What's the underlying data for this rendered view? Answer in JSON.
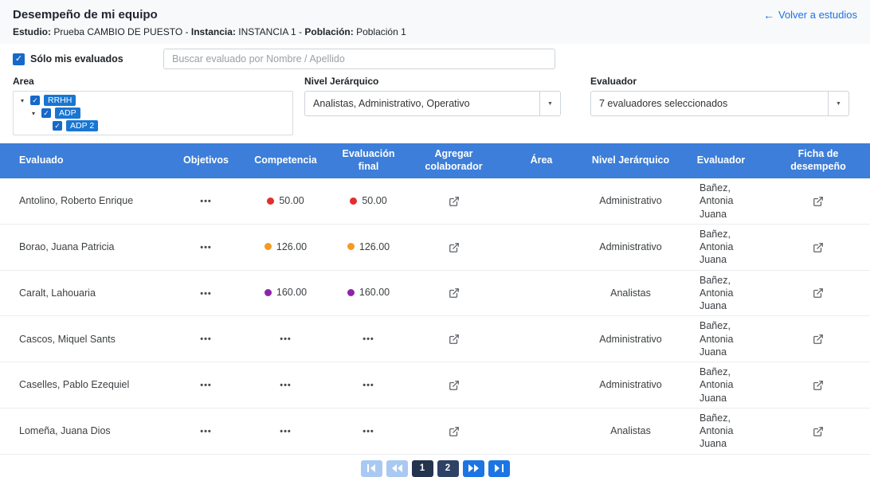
{
  "header": {
    "title": "Desempeño de mi equipo",
    "back_link": "Volver a estudios"
  },
  "study_info": {
    "estudio_label": "Estudio:",
    "estudio_value": "Prueba CAMBIO DE PUESTO",
    "sep1": "-",
    "instancia_label": "Instancia:",
    "instancia_value": "INSTANCIA 1",
    "sep2": "-",
    "poblacion_label": "Población:",
    "poblacion_value": "Población 1"
  },
  "filters": {
    "only_mine_label": "Sólo mis evaluados",
    "only_mine_checked": true,
    "search_placeholder": "Buscar evaluado por Nombre / Apellido",
    "area": {
      "label": "Area",
      "tree": [
        {
          "label": "RRHH",
          "checked": true
        },
        {
          "label": "ADP",
          "checked": true
        },
        {
          "label": "ADP 2",
          "checked": true
        }
      ]
    },
    "nivel": {
      "label": "Nivel Jerárquico",
      "value": "Analistas, Administrativo, Operativo"
    },
    "evaluador": {
      "label": "Evaluador",
      "value": "7 evaluadores seleccionados"
    }
  },
  "table": {
    "columns": [
      "Evaluado",
      "Objetivos",
      "Competencia",
      "Evaluación final",
      "Agregar colaborador",
      "Área",
      "Nivel Jerárquico",
      "Evaluador",
      "Ficha de desempeño"
    ],
    "rows": [
      {
        "evaluado": "Antolino, Roberto Enrique",
        "objetivos": "•••",
        "competencia_dot": "#e02f2f",
        "competencia": "50.00",
        "final_dot": "#e02f2f",
        "final": "50.00",
        "area": "",
        "nivel": "Administrativo",
        "evaluador": "Bañez, Antonia Juana"
      },
      {
        "evaluado": "Borao, Juana Patricia",
        "objetivos": "•••",
        "competencia_dot": "#f59a23",
        "competencia": "126.00",
        "final_dot": "#f59a23",
        "final": "126.00",
        "area": "",
        "nivel": "Administrativo",
        "evaluador": "Bañez, Antonia Juana"
      },
      {
        "evaluado": "Caralt, Lahouaria",
        "objetivos": "•••",
        "competencia_dot": "#8e24aa",
        "competencia": "160.00",
        "final_dot": "#8e24aa",
        "final": "160.00",
        "area": "",
        "nivel": "Analistas",
        "evaluador": "Bañez, Antonia Juana"
      },
      {
        "evaluado": "Cascos, Miquel Sants",
        "objetivos": "•••",
        "competencia_dot": "",
        "competencia": "•••",
        "final_dot": "",
        "final": "•••",
        "area": "",
        "nivel": "Administrativo",
        "evaluador": "Bañez, Antonia Juana"
      },
      {
        "evaluado": "Caselles, Pablo Ezequiel",
        "objetivos": "•••",
        "competencia_dot": "",
        "competencia": "•••",
        "final_dot": "",
        "final": "•••",
        "area": "",
        "nivel": "Administrativo",
        "evaluador": "Bañez, Antonia Juana"
      },
      {
        "evaluado": "Lomeña, Juana Dios",
        "objetivos": "•••",
        "competencia_dot": "",
        "competencia": "•••",
        "final_dot": "",
        "final": "•••",
        "area": "",
        "nivel": "Analistas",
        "evaluador": "Bañez, Antonia Juana"
      }
    ]
  },
  "pagination": {
    "pages": [
      "1",
      "2"
    ],
    "active": "1"
  },
  "icons": {
    "back": "←",
    "caret": "▾",
    "check": "✓",
    "dropdown": "▼",
    "external_link": "open-in-new",
    "first": "first-page",
    "prev": "previous-page",
    "next": "next-page",
    "last": "last-page"
  },
  "colors": {
    "table_header": "#3c7ed9",
    "checkbox_blue": "#1669c9",
    "tree_chip": "#1976d2",
    "link_blue": "#1a73e8",
    "dot_red": "#e02f2f",
    "dot_orange": "#f59a23",
    "dot_purple": "#8e24aa",
    "pager_disabled": "#a9c9f3",
    "pager_nav": "#1b76e3",
    "pager_page": "#2e4265",
    "pager_active": "#24334e"
  }
}
